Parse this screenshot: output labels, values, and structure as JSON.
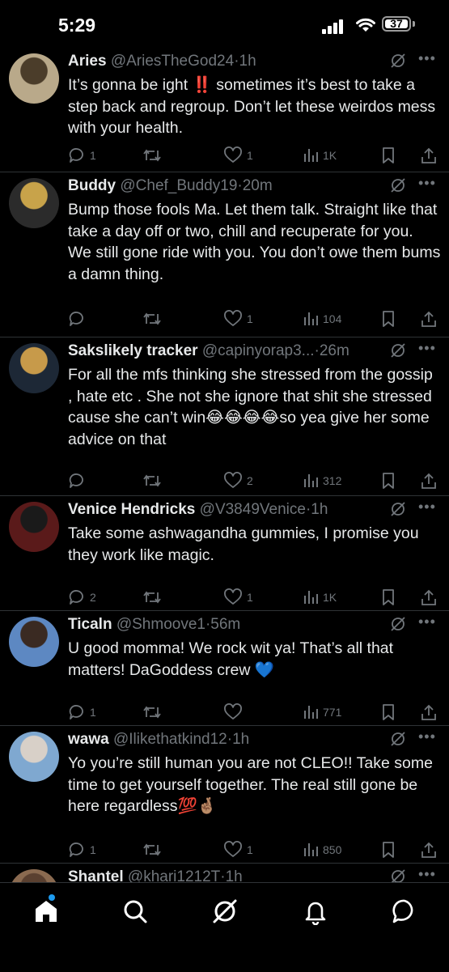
{
  "status_bar": {
    "time": "5:29",
    "battery": "37"
  },
  "tweets": [
    {
      "name": "Aries",
      "handle": "@AriesTheGod24",
      "time": "1h",
      "text": "It’s gonna be ight ‼️ sometimes it’s best to take a step back and regroup. Don’t let these weirdos mess with your health.",
      "replies": "1",
      "reposts": "",
      "likes": "1",
      "views": "1K"
    },
    {
      "name": "Buddy",
      "handle": "@Chef_Buddy19",
      "time": "20m",
      "text": "Bump those fools Ma. Let them talk. Straight like that take a day off or two, chill and recuperate for you. We still gone ride with you. You don’t owe them bums a damn thing.",
      "replies": "",
      "reposts": "",
      "likes": "1",
      "views": "104"
    },
    {
      "name": "Sakslikely tracker",
      "handle": "@capinyorap3...",
      "time": "26m",
      "text": "For all the mfs thinking she stressed from the gossip , hate etc . She not she ignore that shit she stressed cause she can’t win😂😂😂😂so yea give her some advice on that",
      "replies": "",
      "reposts": "",
      "likes": "2",
      "views": "312"
    },
    {
      "name": "Venice Hendricks",
      "handle": "@V3849Venice",
      "time": "1h",
      "text": "Take some ashwagandha gummies, I promise you they work like magic.",
      "replies": "2",
      "reposts": "",
      "likes": "1",
      "views": "1K"
    },
    {
      "name": "Ticaln",
      "handle": "@Shmoove1",
      "time": "56m",
      "text": "U good momma! We rock wit ya! That’s all that matters! DaGoddess crew    💙",
      "replies": "1",
      "reposts": "",
      "likes": "",
      "views": "771"
    },
    {
      "name": "wawa",
      "handle": "@Ilikethatkind12",
      "time": "1h",
      "text": "Yo you’re still human you are not CLEO!! Take some time to get yourself together. The real still gone be here regardless💯🤞🏽",
      "replies": "1",
      "reposts": "",
      "likes": "1",
      "views": "850"
    },
    {
      "name": "Shantel",
      "handle": "@khari1212T",
      "time": "1h",
      "text": "",
      "replies": "",
      "reposts": "",
      "likes": "",
      "views": ""
    }
  ],
  "tabs": [
    "home-tab",
    "search-tab",
    "grok-tab",
    "notifications-tab",
    "messages-tab"
  ]
}
